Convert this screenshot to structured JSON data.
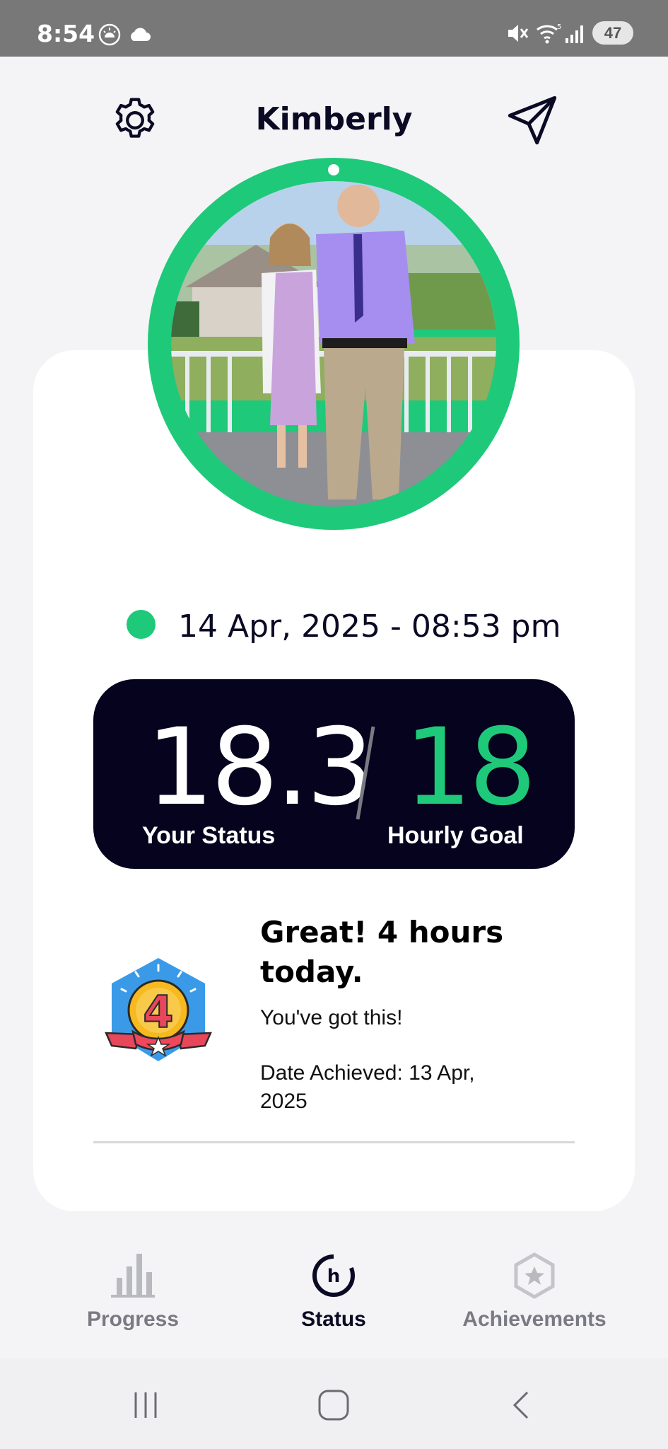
{
  "status_bar": {
    "time": "8:54",
    "battery": "47",
    "icons": [
      "sun-alert-icon",
      "cloud-icon",
      "mute-icon",
      "wifi-icon",
      "signal-icon",
      "battery-icon"
    ]
  },
  "header": {
    "title": "Kimberly",
    "left_icon": "gear-icon",
    "right_icon": "send-icon"
  },
  "profile": {
    "ring_color": "#1fc97a",
    "online_status_color": "#1fc97a",
    "datetime": "14 Apr, 2025 - 08:53 pm"
  },
  "score": {
    "status_value": "18.3",
    "goal_value": "18",
    "status_label": "Your Status",
    "goal_label": "Hourly Goal",
    "goal_color": "#1fc97a",
    "box_color": "#05031d"
  },
  "achievement": {
    "badge_number": "4",
    "title": "Great!  4 hours today.",
    "subtitle": "You've got this!",
    "date_achieved": "Date Achieved: 13 Apr, 2025"
  },
  "bottom_nav": {
    "items": [
      {
        "label": "Progress",
        "icon": "bar-chart-icon",
        "active": false
      },
      {
        "label": "Status",
        "icon": "clock-h-icon",
        "active": true
      },
      {
        "label": "Achievements",
        "icon": "star-badge-icon",
        "active": false
      }
    ],
    "active_color": "#0b0a24",
    "inactive_color": "#7a7a82"
  },
  "system_nav": {
    "buttons": [
      "recents-icon",
      "home-icon",
      "back-icon"
    ]
  }
}
